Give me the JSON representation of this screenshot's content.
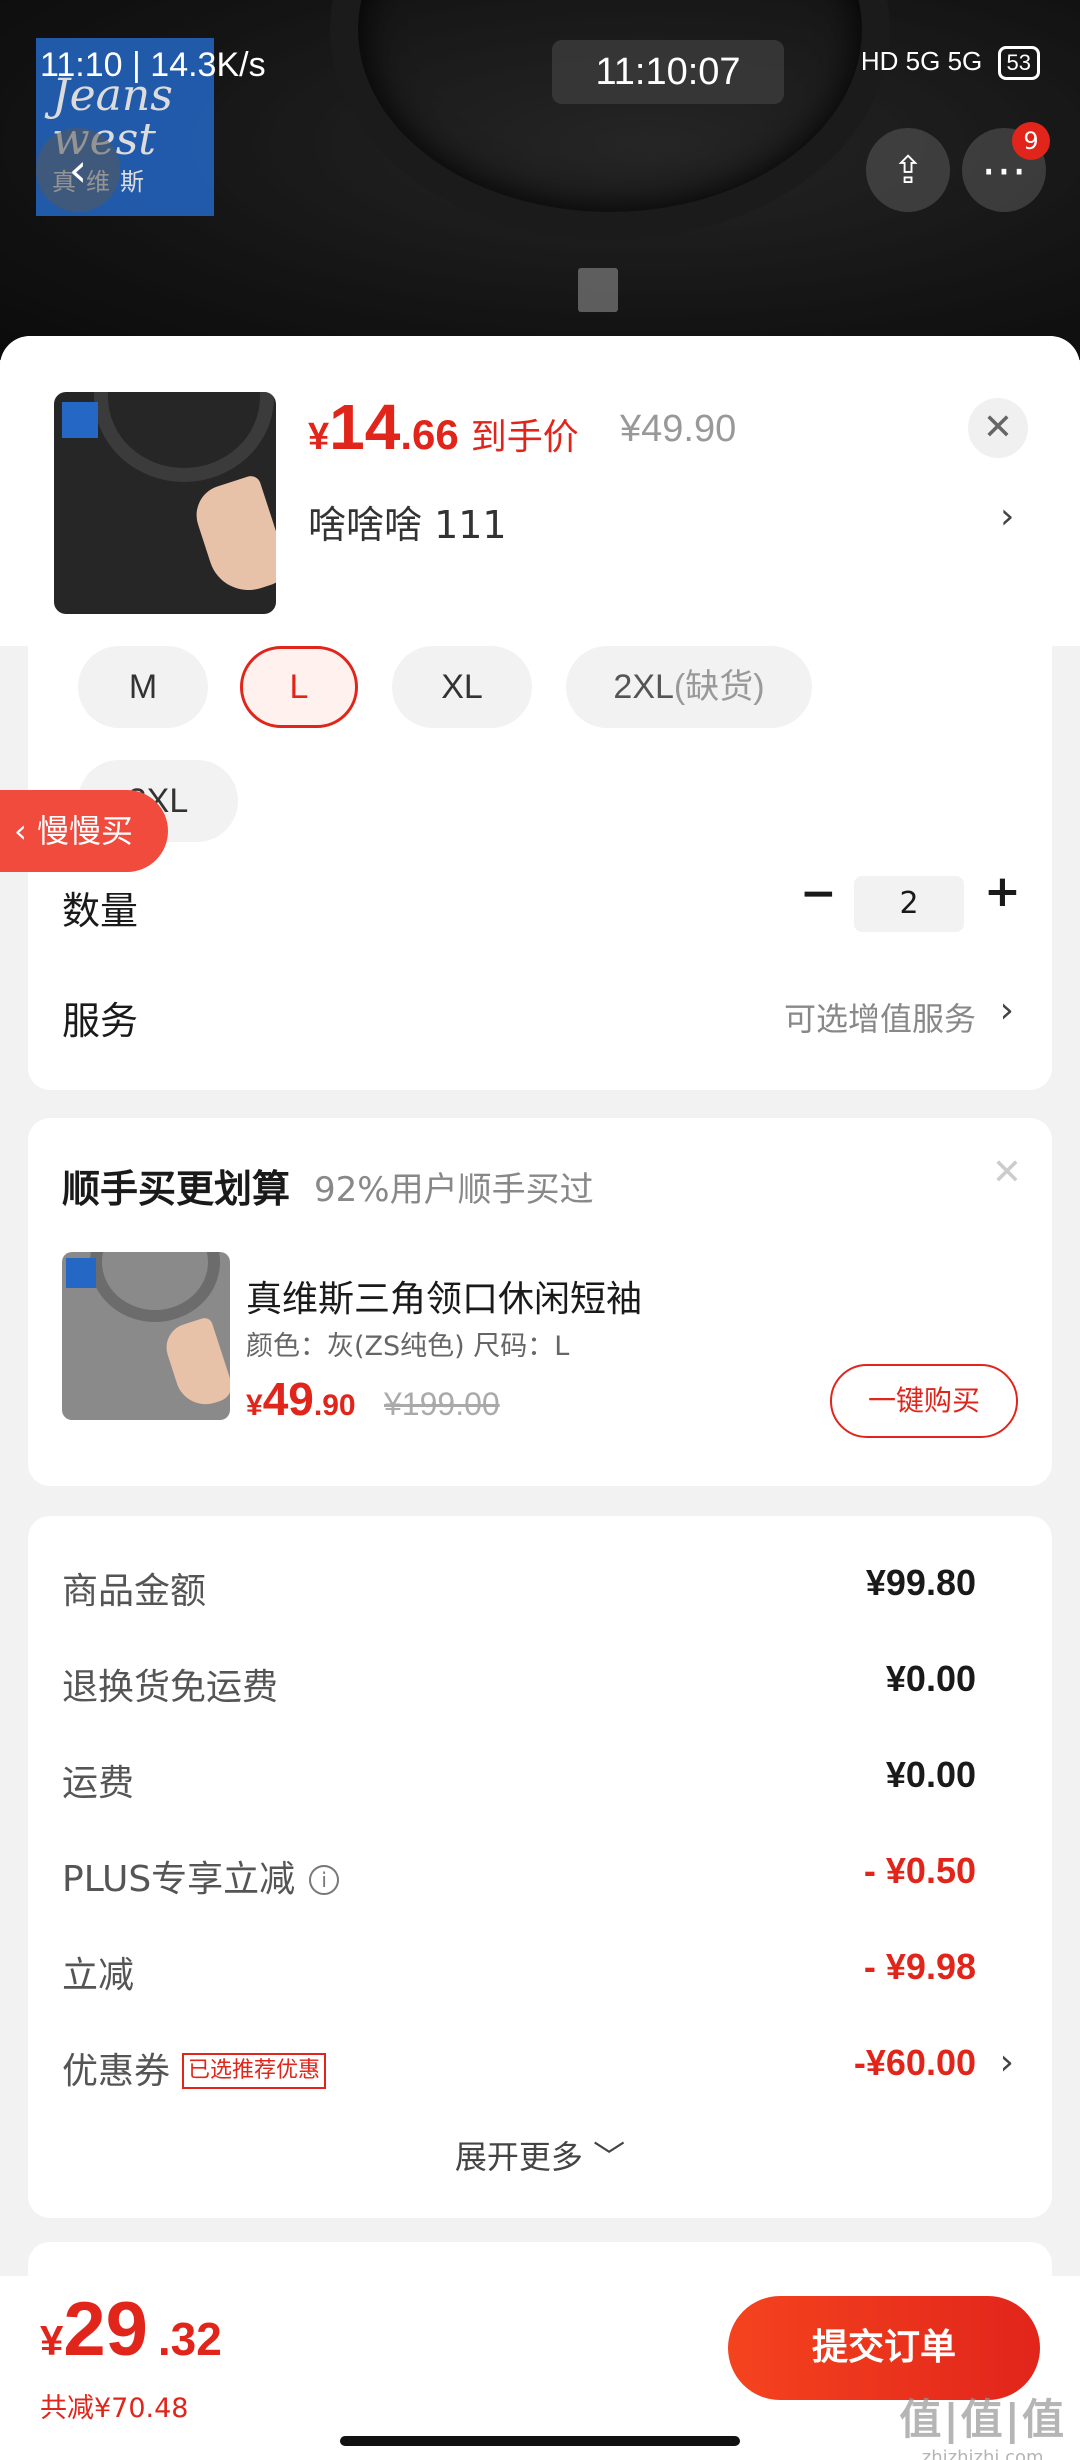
{
  "status_bar": {
    "time_speed": "11:10 | 14.3K/s",
    "clock": "11:10:07",
    "network": "HD 5G 5G",
    "battery": "53"
  },
  "header": {
    "brand_line1": "Jeans west",
    "brand_line2": "真维斯",
    "back_icon": "chevron-left-icon",
    "share_icon": "share-icon",
    "more_icon": "more-dots-icon",
    "more_badge": "9"
  },
  "product": {
    "price_currency": "¥",
    "price_int": "14",
    "price_dec": ".66",
    "price_tag": "到手价",
    "price_original": "¥49.90",
    "variant": "啥啥啥  111",
    "close_icon": "close-icon"
  },
  "sizes": [
    {
      "label": "M",
      "selected": false
    },
    {
      "label": "L",
      "selected": true
    },
    {
      "label": "XL",
      "selected": false
    },
    {
      "label": "2XL",
      "note": "(缺货)",
      "selected": false
    },
    {
      "label": "3XL",
      "selected": false
    }
  ],
  "float_tab": {
    "label": "慢慢买"
  },
  "quantity": {
    "label": "数量",
    "minus": "−",
    "value": "2",
    "plus": "+"
  },
  "service": {
    "label": "服务",
    "hint": "可选增值服务"
  },
  "bundle": {
    "title": "顺手买更划算",
    "subtitle": "92%用户顺手买过",
    "name": "真维斯三角领口休闲短袖",
    "attrs": "颜色：灰(ZS纯色)    尺码：L",
    "price_currency": "¥",
    "price_int": "49",
    "price_dec": ".90",
    "price_original": "¥199.00",
    "buy_label": "一键购买"
  },
  "summary": {
    "rows": [
      {
        "label": "商品金额",
        "value": "¥99.80"
      },
      {
        "label": "退换货免运费",
        "value": "¥0.00"
      },
      {
        "label": "运费",
        "value": "¥0.00"
      },
      {
        "label": "PLUS专享立减",
        "value": "- ¥0.50"
      },
      {
        "label": "立减",
        "value": "- ¥9.98"
      },
      {
        "label": "优惠券",
        "tag": "已选推荐优惠",
        "value": "-¥60.00"
      }
    ],
    "expand_label": "展开更多 ﹀"
  },
  "footer": {
    "total_currency": "¥",
    "total_int": "29",
    "total_dec": ".32",
    "saved": "共减¥70.48",
    "submit_label": "提交订单"
  },
  "watermark": {
    "line1": "值|值|值",
    "line2": "zhizhizhi.com"
  },
  "colors": {
    "accent": "#e1251b",
    "background": "#f2f2f2",
    "brand_blue": "#2467c4"
  }
}
